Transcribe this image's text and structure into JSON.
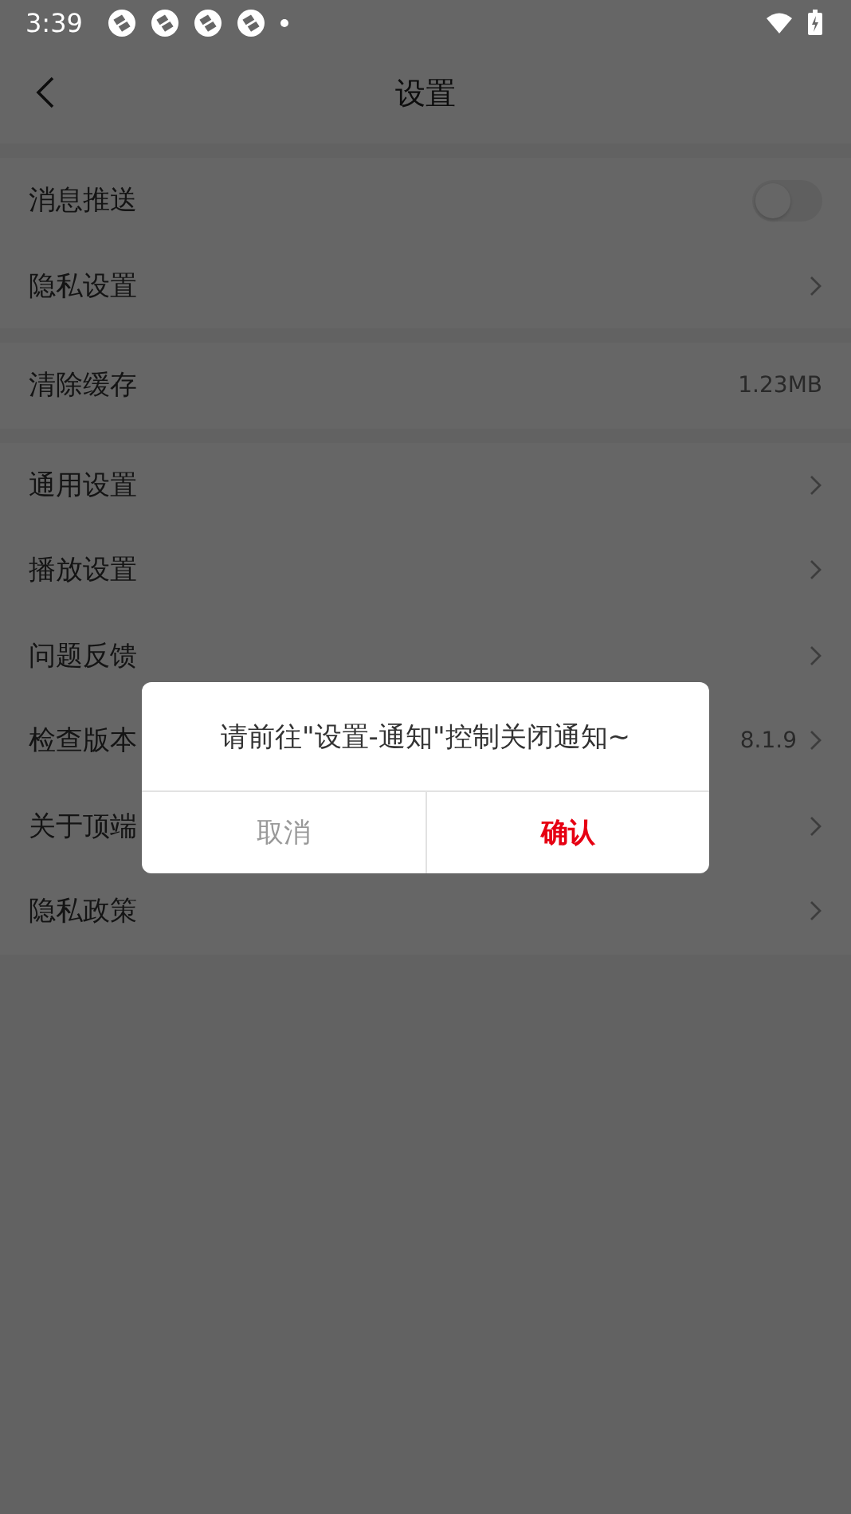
{
  "status_bar": {
    "time": "3:39",
    "charging": true
  },
  "header": {
    "title": "设置"
  },
  "groups": [
    {
      "rows": [
        {
          "label": "消息推送",
          "kind": "toggle",
          "on": false
        },
        {
          "label": "隐私设置",
          "kind": "link"
        }
      ]
    },
    {
      "rows": [
        {
          "label": "清除缓存",
          "kind": "value",
          "value": "1.23MB"
        }
      ]
    },
    {
      "rows": [
        {
          "label": "通用设置",
          "kind": "link"
        },
        {
          "label": "播放设置",
          "kind": "link"
        },
        {
          "label": "问题反馈",
          "kind": "link"
        },
        {
          "label": "检查版本",
          "kind": "link",
          "value": "8.1.9"
        },
        {
          "label": "关于顶端",
          "kind": "link"
        },
        {
          "label": "隐私政策",
          "kind": "link"
        }
      ]
    }
  ],
  "dialog": {
    "message": "请前往\"设置-通知\"控制关闭通知~",
    "buttons": [
      {
        "label": "取消",
        "kind": "cancel"
      },
      {
        "label": "确认",
        "kind": "confirm"
      }
    ]
  }
}
